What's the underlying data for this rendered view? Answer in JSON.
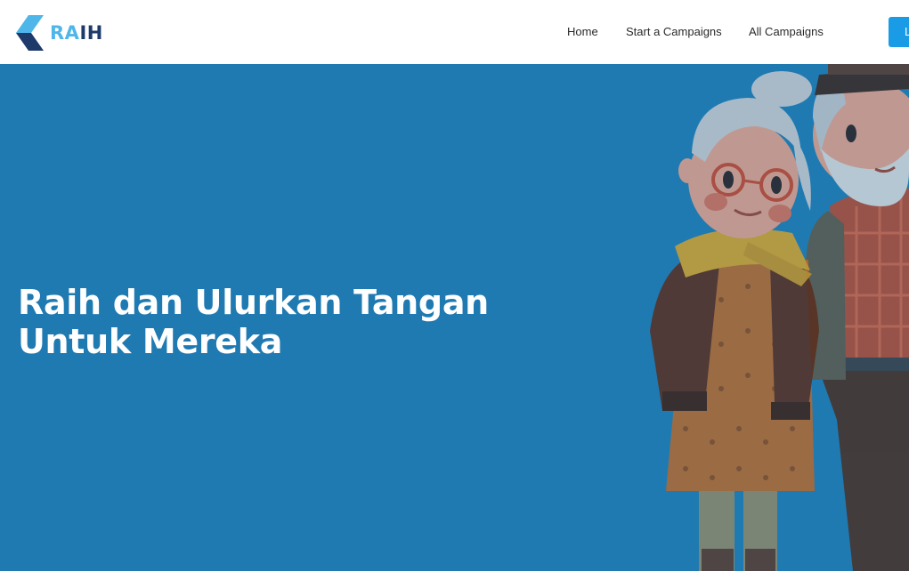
{
  "brand": {
    "logo_ra": "RA",
    "logo_ih": "IH",
    "colors": {
      "light_blue": "#4fb6ea",
      "dark_blue": "#1d3a6b"
    }
  },
  "nav": {
    "items": [
      {
        "label": "Home"
      },
      {
        "label": "Start a Campaigns"
      },
      {
        "label": "All Campaigns"
      }
    ],
    "cta_label": "L"
  },
  "hero": {
    "title_line1": "Raih dan Ulurkan Tangan",
    "title_line2": "Untuk Mereka",
    "background": "#207ab2",
    "illustration": "elderly-couple-illustration"
  }
}
